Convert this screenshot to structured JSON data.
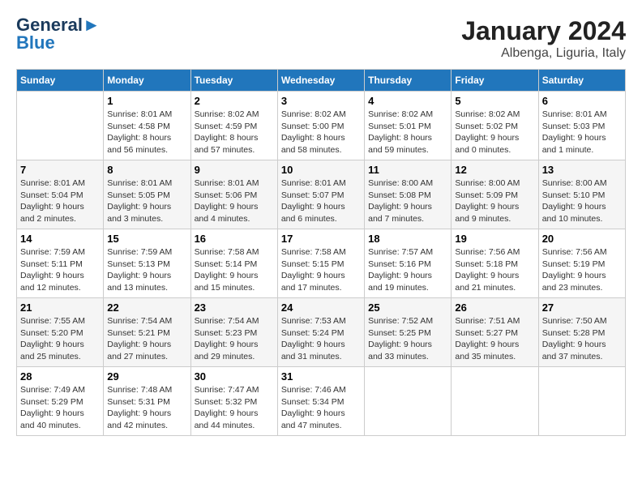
{
  "header": {
    "logo_line1": "General",
    "logo_line2": "Blue",
    "month_year": "January 2024",
    "location": "Albenga, Liguria, Italy"
  },
  "days_of_week": [
    "Sunday",
    "Monday",
    "Tuesday",
    "Wednesday",
    "Thursday",
    "Friday",
    "Saturday"
  ],
  "weeks": [
    [
      {
        "day": "",
        "info": ""
      },
      {
        "day": "1",
        "info": "Sunrise: 8:01 AM\nSunset: 4:58 PM\nDaylight: 8 hours\nand 56 minutes."
      },
      {
        "day": "2",
        "info": "Sunrise: 8:02 AM\nSunset: 4:59 PM\nDaylight: 8 hours\nand 57 minutes."
      },
      {
        "day": "3",
        "info": "Sunrise: 8:02 AM\nSunset: 5:00 PM\nDaylight: 8 hours\nand 58 minutes."
      },
      {
        "day": "4",
        "info": "Sunrise: 8:02 AM\nSunset: 5:01 PM\nDaylight: 8 hours\nand 59 minutes."
      },
      {
        "day": "5",
        "info": "Sunrise: 8:02 AM\nSunset: 5:02 PM\nDaylight: 9 hours\nand 0 minutes."
      },
      {
        "day": "6",
        "info": "Sunrise: 8:01 AM\nSunset: 5:03 PM\nDaylight: 9 hours\nand 1 minute."
      }
    ],
    [
      {
        "day": "7",
        "info": "Sunrise: 8:01 AM\nSunset: 5:04 PM\nDaylight: 9 hours\nand 2 minutes."
      },
      {
        "day": "8",
        "info": "Sunrise: 8:01 AM\nSunset: 5:05 PM\nDaylight: 9 hours\nand 3 minutes."
      },
      {
        "day": "9",
        "info": "Sunrise: 8:01 AM\nSunset: 5:06 PM\nDaylight: 9 hours\nand 4 minutes."
      },
      {
        "day": "10",
        "info": "Sunrise: 8:01 AM\nSunset: 5:07 PM\nDaylight: 9 hours\nand 6 minutes."
      },
      {
        "day": "11",
        "info": "Sunrise: 8:00 AM\nSunset: 5:08 PM\nDaylight: 9 hours\nand 7 minutes."
      },
      {
        "day": "12",
        "info": "Sunrise: 8:00 AM\nSunset: 5:09 PM\nDaylight: 9 hours\nand 9 minutes."
      },
      {
        "day": "13",
        "info": "Sunrise: 8:00 AM\nSunset: 5:10 PM\nDaylight: 9 hours\nand 10 minutes."
      }
    ],
    [
      {
        "day": "14",
        "info": "Sunrise: 7:59 AM\nSunset: 5:11 PM\nDaylight: 9 hours\nand 12 minutes."
      },
      {
        "day": "15",
        "info": "Sunrise: 7:59 AM\nSunset: 5:13 PM\nDaylight: 9 hours\nand 13 minutes."
      },
      {
        "day": "16",
        "info": "Sunrise: 7:58 AM\nSunset: 5:14 PM\nDaylight: 9 hours\nand 15 minutes."
      },
      {
        "day": "17",
        "info": "Sunrise: 7:58 AM\nSunset: 5:15 PM\nDaylight: 9 hours\nand 17 minutes."
      },
      {
        "day": "18",
        "info": "Sunrise: 7:57 AM\nSunset: 5:16 PM\nDaylight: 9 hours\nand 19 minutes."
      },
      {
        "day": "19",
        "info": "Sunrise: 7:56 AM\nSunset: 5:18 PM\nDaylight: 9 hours\nand 21 minutes."
      },
      {
        "day": "20",
        "info": "Sunrise: 7:56 AM\nSunset: 5:19 PM\nDaylight: 9 hours\nand 23 minutes."
      }
    ],
    [
      {
        "day": "21",
        "info": "Sunrise: 7:55 AM\nSunset: 5:20 PM\nDaylight: 9 hours\nand 25 minutes."
      },
      {
        "day": "22",
        "info": "Sunrise: 7:54 AM\nSunset: 5:21 PM\nDaylight: 9 hours\nand 27 minutes."
      },
      {
        "day": "23",
        "info": "Sunrise: 7:54 AM\nSunset: 5:23 PM\nDaylight: 9 hours\nand 29 minutes."
      },
      {
        "day": "24",
        "info": "Sunrise: 7:53 AM\nSunset: 5:24 PM\nDaylight: 9 hours\nand 31 minutes."
      },
      {
        "day": "25",
        "info": "Sunrise: 7:52 AM\nSunset: 5:25 PM\nDaylight: 9 hours\nand 33 minutes."
      },
      {
        "day": "26",
        "info": "Sunrise: 7:51 AM\nSunset: 5:27 PM\nDaylight: 9 hours\nand 35 minutes."
      },
      {
        "day": "27",
        "info": "Sunrise: 7:50 AM\nSunset: 5:28 PM\nDaylight: 9 hours\nand 37 minutes."
      }
    ],
    [
      {
        "day": "28",
        "info": "Sunrise: 7:49 AM\nSunset: 5:29 PM\nDaylight: 9 hours\nand 40 minutes."
      },
      {
        "day": "29",
        "info": "Sunrise: 7:48 AM\nSunset: 5:31 PM\nDaylight: 9 hours\nand 42 minutes."
      },
      {
        "day": "30",
        "info": "Sunrise: 7:47 AM\nSunset: 5:32 PM\nDaylight: 9 hours\nand 44 minutes."
      },
      {
        "day": "31",
        "info": "Sunrise: 7:46 AM\nSunset: 5:34 PM\nDaylight: 9 hours\nand 47 minutes."
      },
      {
        "day": "",
        "info": ""
      },
      {
        "day": "",
        "info": ""
      },
      {
        "day": "",
        "info": ""
      }
    ]
  ]
}
